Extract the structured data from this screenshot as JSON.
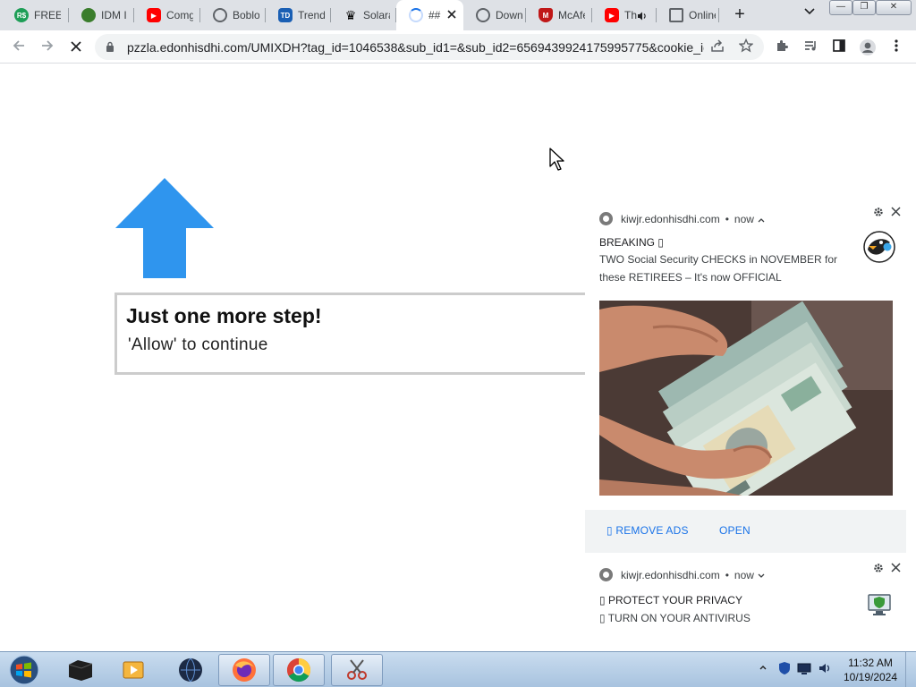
{
  "browser": {
    "tabs": [
      {
        "label": "FREE f",
        "icon": "green-cash-icon",
        "favicon_text": "R$",
        "favicon_color": "#1e9e57"
      },
      {
        "label": "IDM I",
        "icon": "idm-globe-icon",
        "favicon_text": "",
        "favicon_color": "#3a7d2c"
      },
      {
        "label": "Comg",
        "icon": "youtube-icon",
        "favicon_text": "▶",
        "favicon_color": "#ff0000"
      },
      {
        "label": "Boblo",
        "icon": "globe-icon",
        "favicon_text": "",
        "favicon_color": "#5f6368"
      },
      {
        "label": "Trend",
        "icon": "trend-micro-icon",
        "favicon_text": "TD",
        "favicon_color": "#1a5fb4"
      },
      {
        "label": "Solara",
        "icon": "crown-icon",
        "favicon_text": "♛",
        "favicon_color": "#f2c200"
      },
      {
        "label": "##",
        "icon": "loading-spinner-icon",
        "favicon_text": "",
        "favicon_color": "#1a73e8",
        "active": true
      },
      {
        "label": "Down",
        "icon": "globe-icon",
        "favicon_text": "",
        "favicon_color": "#5f6368"
      },
      {
        "label": "McAfe",
        "icon": "mcafee-shield-icon",
        "favicon_text": "M",
        "favicon_color": "#c01818"
      },
      {
        "label": "Th",
        "icon": "youtube-icon",
        "favicon_text": "▶",
        "favicon_color": "#ff0000",
        "audio": true
      },
      {
        "label": "Online",
        "icon": "document-icon",
        "favicon_text": "",
        "favicon_color": "#5f6368"
      }
    ],
    "url": "pzzla.edonhisdhi.com/UMIXDH?tag_id=1046538&sub_id1=&sub_id2=6569439924175995775&cookie_id=",
    "window_buttons": {
      "minimize": "—",
      "restore": "❐",
      "close": "✕"
    }
  },
  "page": {
    "step_title": "Just one more step!",
    "step_sub": "'Allow' to continue",
    "arrow_color": "#2f95ee"
  },
  "notifications": [
    {
      "source": "kiwjr.edonhisdhi.com",
      "time": "now",
      "title": "BREAKING ▯",
      "body": "TWO Social Security CHECKS in NOVEMBER for these RETIREES – It's now OFFICIAL",
      "actions": [
        "▯ REMOVE ADS",
        "OPEN"
      ],
      "image_icon": "cash-money-photo"
    },
    {
      "source": "kiwjr.edonhisdhi.com",
      "time": "now",
      "line1": "▯ PROTECT YOUR PRIVACY",
      "line2": "▯ TURN ON YOUR ANTIVIRUS"
    }
  ],
  "taskbar": {
    "time": "11:32 AM",
    "date": "10/19/2024"
  }
}
